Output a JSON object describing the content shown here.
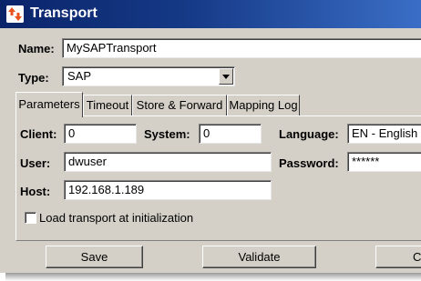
{
  "window": {
    "title": "Transport",
    "icon": "transport-arrows-icon",
    "title_color": "#0a246a"
  },
  "form": {
    "name_label": "Name:",
    "name_value": "MySAPTransport",
    "type_label": "Type:",
    "type_value": "SAP"
  },
  "tabs": [
    {
      "label": "Parameters",
      "active": true
    },
    {
      "label": "Timeout",
      "active": false
    },
    {
      "label": "Store & Forward",
      "active": false
    },
    {
      "label": "Mapping Log",
      "active": false
    }
  ],
  "parameters": {
    "client_label": "Client:",
    "client_value": "0",
    "system_label": "System:",
    "system_value": "0",
    "language_label": "Language:",
    "language_value": "EN - English",
    "user_label": "User:",
    "user_value": "dwuser",
    "password_label": "Password:",
    "password_value": "******",
    "host_label": "Host:",
    "host_value": "192.168.1.189",
    "load_checkbox_label": "Load transport at initialization",
    "load_checkbox_checked": false
  },
  "buttons": {
    "save": "Save",
    "validate": "Validate",
    "third_partial": "C"
  }
}
